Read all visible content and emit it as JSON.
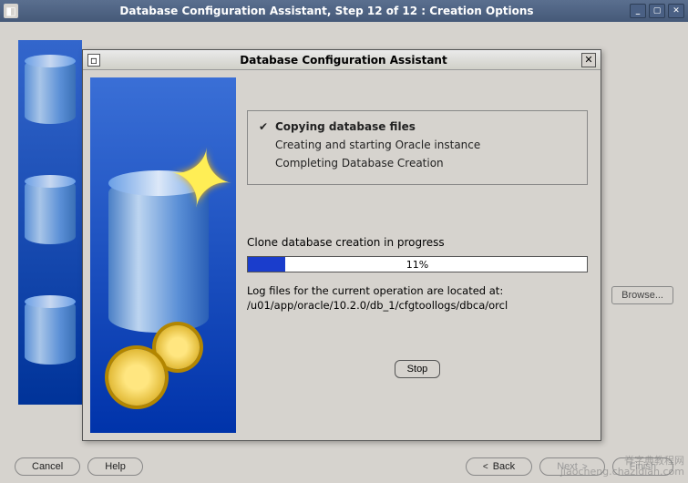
{
  "parent_window": {
    "title": "Database Configuration Assistant, Step 12 of 12 : Creation Options",
    "buttons": {
      "cancel": "Cancel",
      "help": "Help",
      "back": "Back",
      "next": "Next",
      "finish": "Finish",
      "browse": "Browse..."
    }
  },
  "dialog": {
    "title": "Database Configuration Assistant",
    "steps": [
      {
        "label": "Copying database files",
        "current": true
      },
      {
        "label": "Creating and starting Oracle instance",
        "current": false
      },
      {
        "label": "Completing Database Creation",
        "current": false
      }
    ],
    "progress": {
      "label": "Clone database creation in progress",
      "percent_text": "11%",
      "percent_value": 11
    },
    "log_info": {
      "line1": "Log files for the current operation are located at:",
      "line2": "/u01/app/oracle/10.2.0/db_1/cfgtoollogs/dbca/orcl"
    },
    "stop_label": "Stop"
  },
  "watermark": {
    "line1": "脊字典教程网",
    "line2": "jiaocheng.chazidian.com"
  }
}
